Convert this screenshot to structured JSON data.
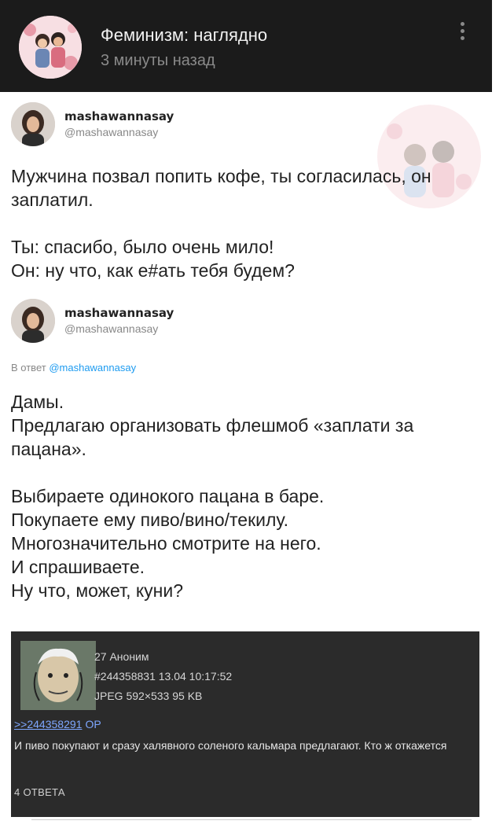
{
  "header": {
    "group_name": "Феминизм: наглядно",
    "time": "3 минуты назад"
  },
  "tweet1": {
    "name": "mashawannasay",
    "handle": "@mashawannasay",
    "text": "Мужчина позвал попить кофе, ты согласилась, он\nзаплатил.\n\nТы: спасибо, было очень мило!\nОн: ну что, как е#ать тебя будем?"
  },
  "tweet2": {
    "name": "mashawannasay",
    "handle": "@mashawannasay",
    "reply_prefix": "В ответ",
    "reply_mention": "@mashawannasay",
    "text": "Дамы.\nПредлагаю организовать флешмоб «заплати за\nпацана».\n\nВыбираете одинокого пацана в баре.\nПокупаете ему пиво/вино/текилу.\nМногозначительно смотрите на него.\nИ спрашиваете.\nНу что, может, куни?"
  },
  "anon": {
    "line1": "27 Аноним",
    "line2": "#244358831 13.04 10:17:52",
    "line3": "JPEG 592×533 95 KB",
    "reply_link": ">>244358291",
    "op_label": "OP",
    "text": "И пиво покупают и сразу халявного соленого кальмара предлагают. Кто ж откажется",
    "replies": "4 ОТВЕТА"
  }
}
